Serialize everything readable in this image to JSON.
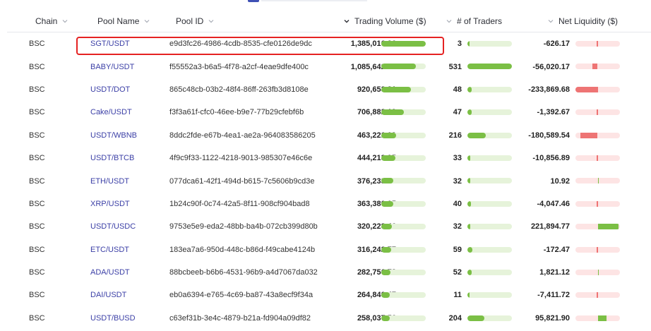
{
  "columns": {
    "chain": "Chain",
    "pool_name": "Pool Name",
    "pool_id": "Pool ID",
    "trading_volume": "Trading Volume ($)",
    "traders": "# of Traders",
    "net_liquidity": "Net Liquidity ($)"
  },
  "sort": {
    "column": "trading_volume",
    "direction": "desc"
  },
  "colors": {
    "link": "#3b3fa6",
    "bar_positive": "#7bbf45",
    "bar_positive_track": "#e6f3da",
    "bar_negative": "#ee7474",
    "bar_negative_track": "#fde4e4",
    "highlight": "#e52222",
    "tab_accent": "#3f51b5"
  },
  "highlighted_row": 0,
  "rows": [
    {
      "chain": "BSC",
      "pool": "SGT/USDT",
      "id": "e9d3fc26-4986-4cdb-8535-cfe0126de9dc",
      "volume": "1,385,016.36",
      "volume_value": 1385016.36,
      "traders": "3",
      "traders_value": 3,
      "liquidity": "-626.17",
      "liquidity_value": -626.17
    },
    {
      "chain": "BSC",
      "pool": "BABY/USDT",
      "id": "f55552a3-b6a5-4f78-a2cf-4eae9dfe400c",
      "volume": "1,085,642.86",
      "volume_value": 1085642.86,
      "traders": "531",
      "traders_value": 531,
      "liquidity": "-56,020.17",
      "liquidity_value": -56020.17
    },
    {
      "chain": "BSC",
      "pool": "USDT/DOT",
      "id": "865c48cb-03b2-48f4-86ff-263fb3d8108e",
      "volume": "920,653.81",
      "volume_value": 920653.81,
      "traders": "48",
      "traders_value": 48,
      "liquidity": "-233,869.68",
      "liquidity_value": -233869.68
    },
    {
      "chain": "BSC",
      "pool": "Cake/USDT",
      "id": "f3f3a61f-cfc0-46ee-b9e7-77b29cfebf6b",
      "volume": "706,882.19",
      "volume_value": 706882.19,
      "traders": "47",
      "traders_value": 47,
      "liquidity": "-1,392.67",
      "liquidity_value": -1392.67
    },
    {
      "chain": "BSC",
      "pool": "USDT/WBNB",
      "id": "8ddc2fde-e67b-4ea1-ae2a-964083586205",
      "volume": "463,221.03",
      "volume_value": 463221.03,
      "traders": "216",
      "traders_value": 216,
      "liquidity": "-180,589.54",
      "liquidity_value": -180589.54
    },
    {
      "chain": "BSC",
      "pool": "USDT/BTCB",
      "id": "4f9c9f33-1122-4218-9013-985307e46c6e",
      "volume": "444,213.95",
      "volume_value": 444213.95,
      "traders": "33",
      "traders_value": 33,
      "liquidity": "-10,856.89",
      "liquidity_value": -10856.89
    },
    {
      "chain": "BSC",
      "pool": "ETH/USDT",
      "id": "077dca61-42f1-494d-b615-7c5606b9cd3e",
      "volume": "376,233.24",
      "volume_value": 376233.24,
      "traders": "32",
      "traders_value": 32,
      "liquidity": "10.92",
      "liquidity_value": 10.92
    },
    {
      "chain": "BSC",
      "pool": "XRP/USDT",
      "id": "1b24c90f-0c74-42a5-8f11-908cf904bad8",
      "volume": "363,380.05",
      "volume_value": 363380.05,
      "traders": "40",
      "traders_value": 40,
      "liquidity": "-4,047.46",
      "liquidity_value": -4047.46
    },
    {
      "chain": "BSC",
      "pool": "USDT/USDC",
      "id": "9753e5e9-eda2-48bb-ba4b-072cb399d80b",
      "volume": "320,228.46",
      "volume_value": 320228.46,
      "traders": "32",
      "traders_value": 32,
      "liquidity": "221,894.77",
      "liquidity_value": 221894.77
    },
    {
      "chain": "BSC",
      "pool": "ETC/USDT",
      "id": "183ea7a6-950d-448c-b86d-f49cabe4124b",
      "volume": "316,242.77",
      "volume_value": 316242.77,
      "traders": "59",
      "traders_value": 59,
      "liquidity": "-172.47",
      "liquidity_value": -172.47
    },
    {
      "chain": "BSC",
      "pool": "ADA/USDT",
      "id": "88bcbeeb-b6b6-4531-96b9-a4d7067da032",
      "volume": "282,756.73",
      "volume_value": 282756.73,
      "traders": "52",
      "traders_value": 52,
      "liquidity": "1,821.12",
      "liquidity_value": 1821.12
    },
    {
      "chain": "BSC",
      "pool": "DAI/USDT",
      "id": "eb0a6394-e765-4c69-ba87-43a8ecf9f34a",
      "volume": "264,840.47",
      "volume_value": 264840.47,
      "traders": "11",
      "traders_value": 11,
      "liquidity": "-7,411.72",
      "liquidity_value": -7411.72
    },
    {
      "chain": "BSC",
      "pool": "USDT/BUSD",
      "id": "c63ef31b-3e4c-4879-b21a-fd904a09df82",
      "volume": "258,037.56",
      "volume_value": 258037.56,
      "traders": "204",
      "traders_value": 204,
      "liquidity": "95,821.90",
      "liquidity_value": 95821.9
    }
  ]
}
